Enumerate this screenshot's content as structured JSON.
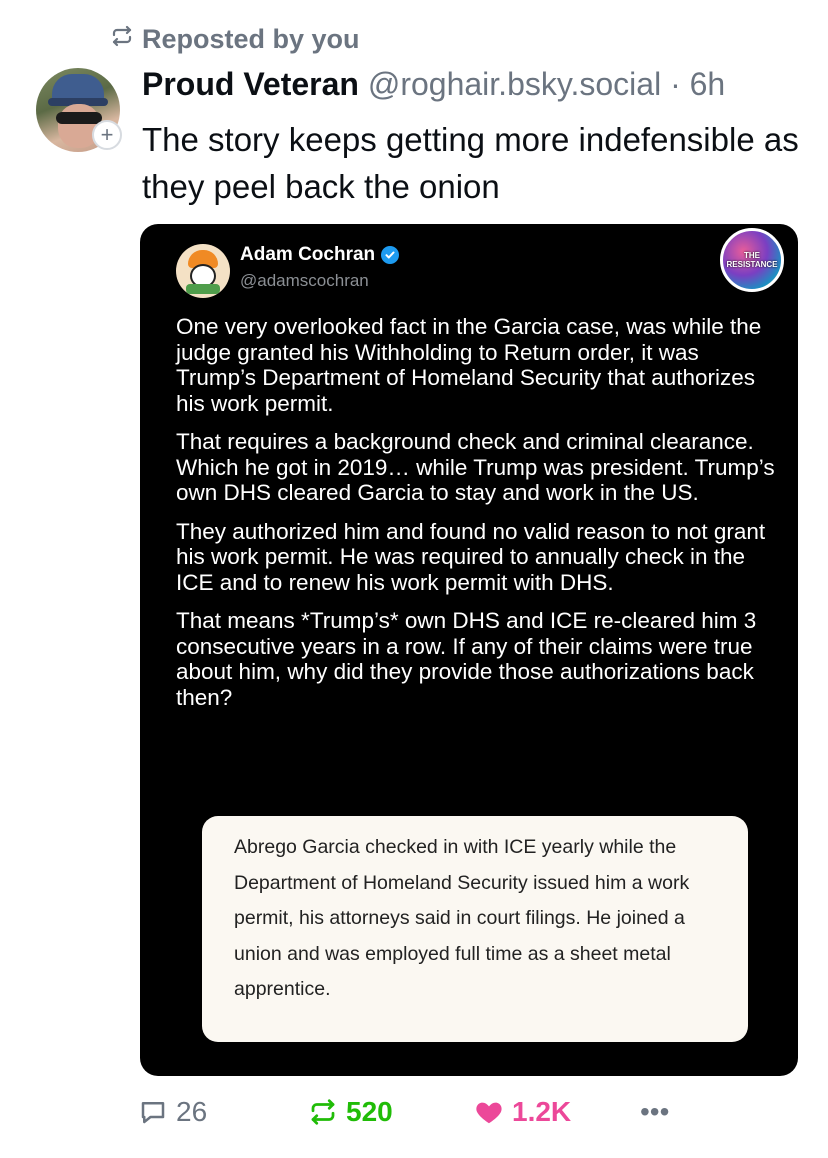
{
  "repost_label": "Reposted by you",
  "post": {
    "author_name": "Proud Veteran",
    "author_handle": "@roghair.bsky.social",
    "separator": "·",
    "time": "6h",
    "text": "The story keeps getting more indefensible as they peel back the onion"
  },
  "embed": {
    "name": "Adam Cochran",
    "handle": "@adamscochran",
    "badge_text": "THE RESISTANCE",
    "paragraphs": [
      "One very overlooked fact in the Garcia case, was while the judge granted his Withholding to Return order, it was Trump’s Department of Homeland Security that authorizes his work permit.",
      "That requires a background check and criminal clearance. Which he got in 2019… while Trump was president. Trump’s own DHS cleared Garcia to stay and work in the US.",
      "They authorized him and found no valid reason to not grant his work permit. He was required to annually check in the ICE and to renew his work permit with DHS.",
      "That means *Trump’s* own DHS and ICE re-cleared him 3 consecutive years in a row. If any of their claims were true about him, why did they provide those authorizations back then?"
    ],
    "quote": "Abrego Garcia checked in with ICE yearly while the Department of Homeland Security issued him a work permit, his attorneys said in court filings. He joined a union and was employed full time as a sheet metal apprentice."
  },
  "actions": {
    "replies": "26",
    "reposts": "520",
    "likes": "1.2K",
    "more": "•••"
  },
  "colors": {
    "repost_active": "#20bc07",
    "like_active": "#ec4899",
    "muted": "#6b7480",
    "verified": "#1d9bf0"
  }
}
